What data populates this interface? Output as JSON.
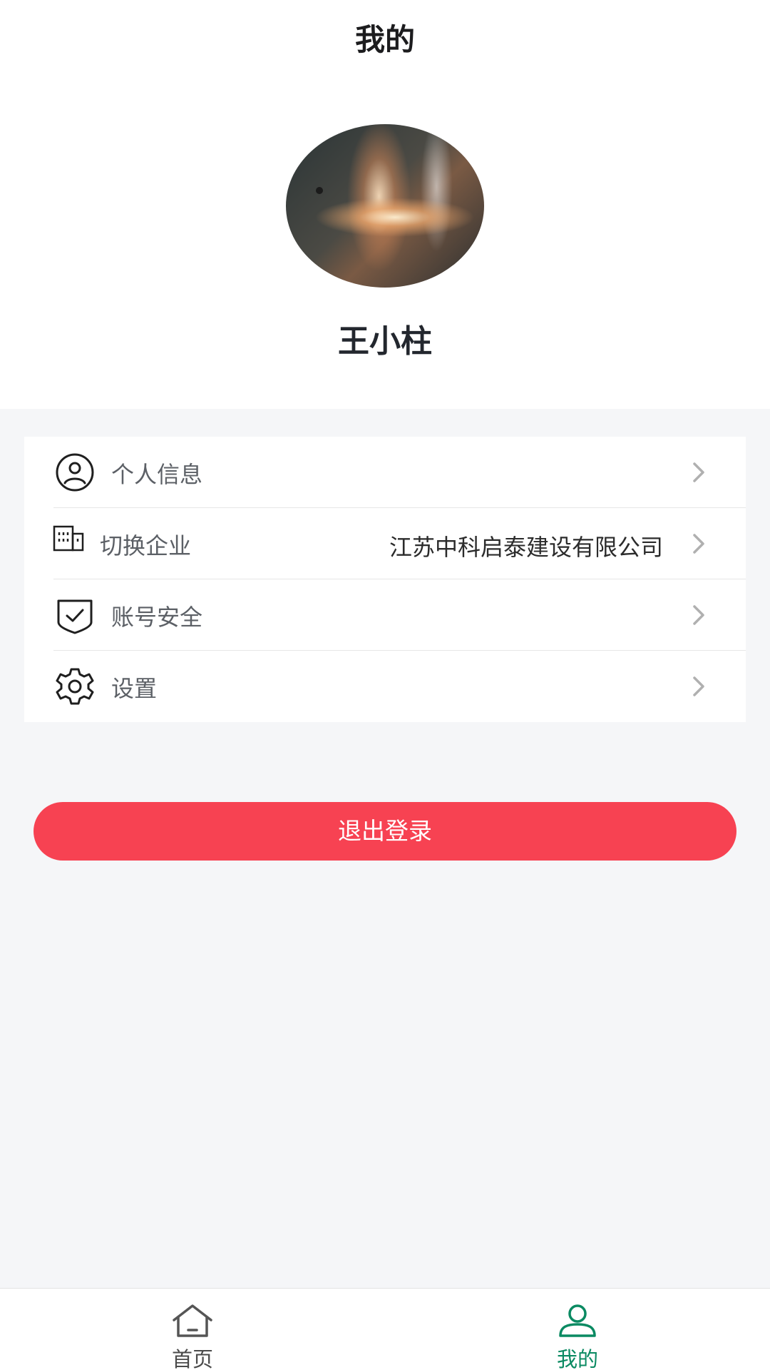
{
  "header": {
    "title": "我的"
  },
  "profile": {
    "name": "王小柱"
  },
  "menu": {
    "items": [
      {
        "label": "个人信息",
        "value": "",
        "icon": "user-circle-icon"
      },
      {
        "label": "切换企业",
        "value": "江苏中科启泰建设有限公司",
        "icon": "building-icon"
      },
      {
        "label": "账号安全",
        "value": "",
        "icon": "shield-check-icon"
      },
      {
        "label": "设置",
        "value": "",
        "icon": "gear-icon"
      }
    ]
  },
  "logout": {
    "label": "退出登录"
  },
  "tabbar": {
    "tabs": [
      {
        "label": "首页",
        "icon": "home-icon",
        "active": false
      },
      {
        "label": "我的",
        "icon": "user-icon",
        "active": true
      }
    ]
  },
  "colors": {
    "accent": "#0a8a62",
    "logout": "#f74252",
    "background": "#f5f6f8"
  }
}
